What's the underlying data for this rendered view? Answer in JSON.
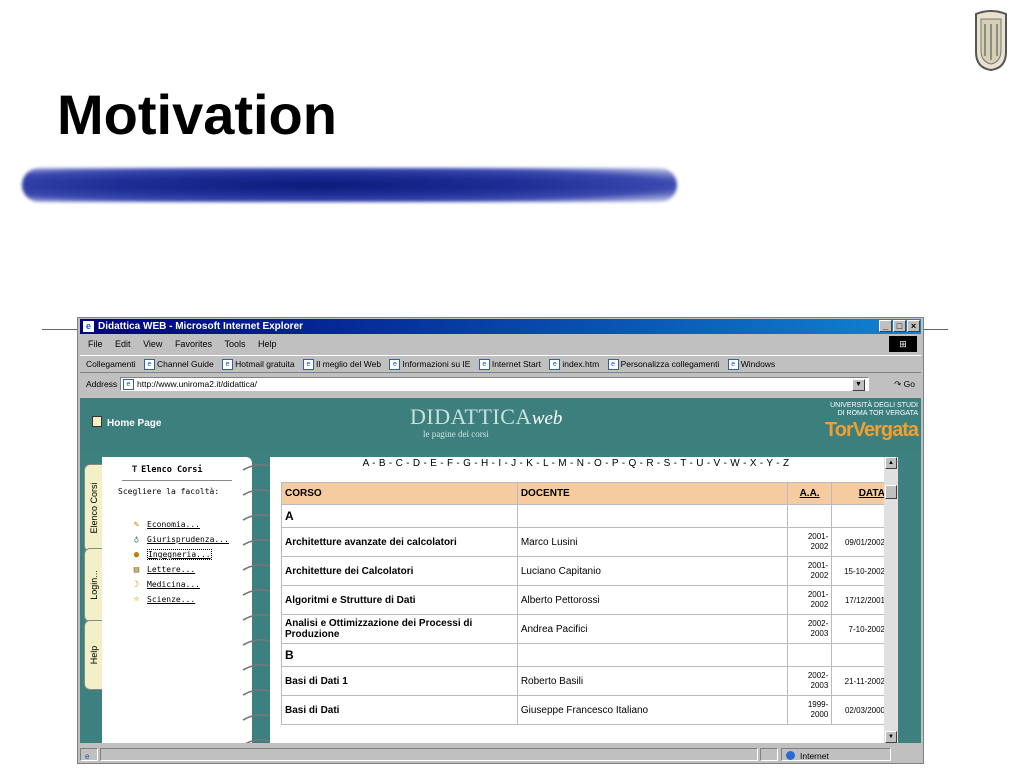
{
  "slide": {
    "title": "Motivation"
  },
  "browser": {
    "window_title": "Didattica WEB - Microsoft Internet Explorer",
    "menu": [
      "File",
      "Edit",
      "View",
      "Favorites",
      "Tools",
      "Help"
    ],
    "links_label": "Collegamenti",
    "links": [
      "Channel Guide",
      "Hotmail gratuita",
      "Il meglio del Web",
      "Informazioni su IE",
      "Internet Start",
      "index.htm",
      "Personalizza collegamenti",
      "Windows"
    ],
    "address_label": "Address",
    "address_url": "http://www.uniroma2.it/didattica/",
    "go_label": "Go",
    "status_zone": "Internet"
  },
  "site": {
    "home_label": "Home Page",
    "brand_main": "DIDATTICA",
    "brand_web": "web",
    "brand_sub": "le pagine dei corsi",
    "univ_line1": "UNIVERSITÀ DEGLI STUDI",
    "univ_line2": "DI ROMA TOR VERGATA",
    "univ_logo": "TorVergata",
    "tabs": [
      "Elenco Corsi",
      "Login...",
      "Help"
    ],
    "panel_title": "Elenco Corsi",
    "panel_subtitle": "Scegliere la facoltà:",
    "faculties": [
      "Economia...",
      "Giurisprudenza...",
      "Ingegneria...",
      "Lettere...",
      "Medicina...",
      "Scienze..."
    ],
    "alphabet": "A - B - C - D - E - F - G - H - I - J - K - L - M - N - O - P - Q - R - S - T - U - V - W - X - Y - Z",
    "table": {
      "headers": [
        "CORSO",
        "DOCENTE",
        "A.A.",
        "DATA"
      ],
      "rows": [
        {
          "letter": "A"
        },
        {
          "corso": "Architetture avanzate dei calcolatori",
          "docente": "Marco Lusini",
          "aa1": "2001-",
          "aa2": "2002",
          "data": "09/01/2002"
        },
        {
          "corso": "Architetture dei Calcolatori",
          "docente": "Luciano Capitanio",
          "aa1": "2001-",
          "aa2": "2002",
          "data": "15-10-2002"
        },
        {
          "corso": "Algoritmi e Strutture di Dati",
          "docente": "Alberto Pettorossi",
          "aa1": "2001-",
          "aa2": "2002",
          "data": "17/12/2001"
        },
        {
          "corso": "Analisi e Ottimizzazione dei Processi di Produzione",
          "docente": "Andrea Pacifici",
          "aa1": "2002-",
          "aa2": "2003",
          "data": "7-10-2002"
        },
        {
          "letter": "B"
        },
        {
          "corso": "Basi di Dati 1",
          "docente": "Roberto Basili",
          "aa1": "2002-",
          "aa2": "2003",
          "data": "21-11-2002"
        },
        {
          "corso": "Basi di Dati",
          "docente": "Giuseppe Francesco Italiano",
          "aa1": "1999-",
          "aa2": "2000",
          "data": "02/03/2000"
        }
      ]
    }
  },
  "colors": {
    "site_bg": "#3c8080",
    "header_row": "#f7cba0",
    "title_bar": "#000080"
  }
}
